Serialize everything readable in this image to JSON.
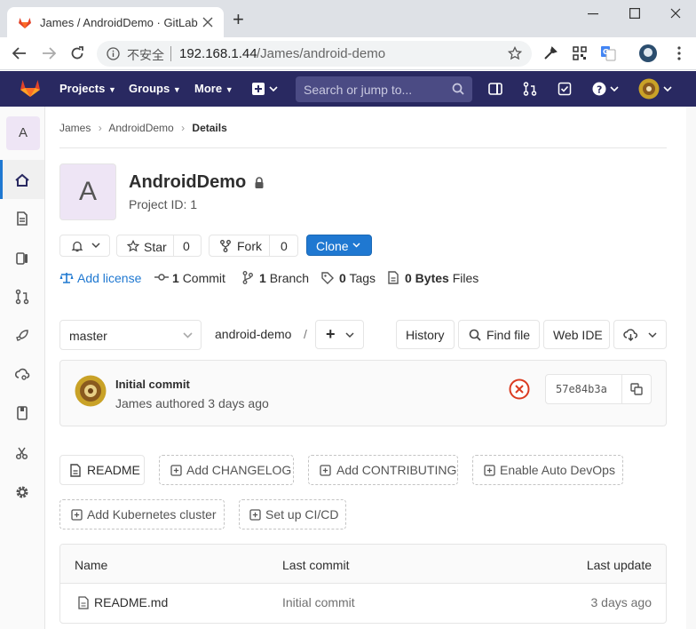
{
  "browser": {
    "tab_title": "James / AndroidDemo · GitLab",
    "new_tab_symbol": "+",
    "security_label": "不安全",
    "url_host": "192.168.1.44",
    "url_path": "/James/android-demo"
  },
  "gitlab_nav": {
    "projects": "Projects",
    "groups": "Groups",
    "more": "More",
    "search_placeholder": "Search or jump to...",
    "accent": "#292961"
  },
  "breadcrumb": {
    "owner": "James",
    "project": "AndroidDemo",
    "current": "Details"
  },
  "project": {
    "avatar_letter": "A",
    "name": "AndroidDemo",
    "id_text": "Project ID: 1",
    "star_label": "Star",
    "star_count": "0",
    "fork_label": "Fork",
    "fork_count": "0",
    "clone_label": "Clone",
    "add_license": "Add license",
    "commits_count": "1",
    "commits_label": "Commit",
    "branches_count": "1",
    "branches_label": "Branch",
    "tags_count": "0",
    "tags_label": "Tags",
    "size_count": "0 Bytes",
    "size_label": "Files"
  },
  "repo_bar": {
    "branch": "master",
    "path": "android-demo",
    "path_sep": "/",
    "add": "+",
    "history": "History",
    "find_file": "Find file",
    "web_ide": "Web IDE"
  },
  "last_commit": {
    "title": "Initial commit",
    "author_line": "James authored 3 days ago",
    "sha": "57e84b3a",
    "status_color": "#db3b21"
  },
  "quick_actions": {
    "readme": "README",
    "add_changelog": "Add CHANGELOG",
    "add_contributing": "Add CONTRIBUTING",
    "enable_auto_devops": "Enable Auto DevOps",
    "add_k8s": "Add Kubernetes cluster",
    "setup_ci": "Set up CI/CD"
  },
  "file_table": {
    "headers": [
      "Name",
      "Last commit",
      "Last update"
    ],
    "rows": [
      {
        "name": "README.md",
        "last_commit": "Initial commit",
        "last_update": "3 days ago"
      }
    ]
  },
  "link_color": "#1f78d1",
  "clone_color": "#1f78d1"
}
